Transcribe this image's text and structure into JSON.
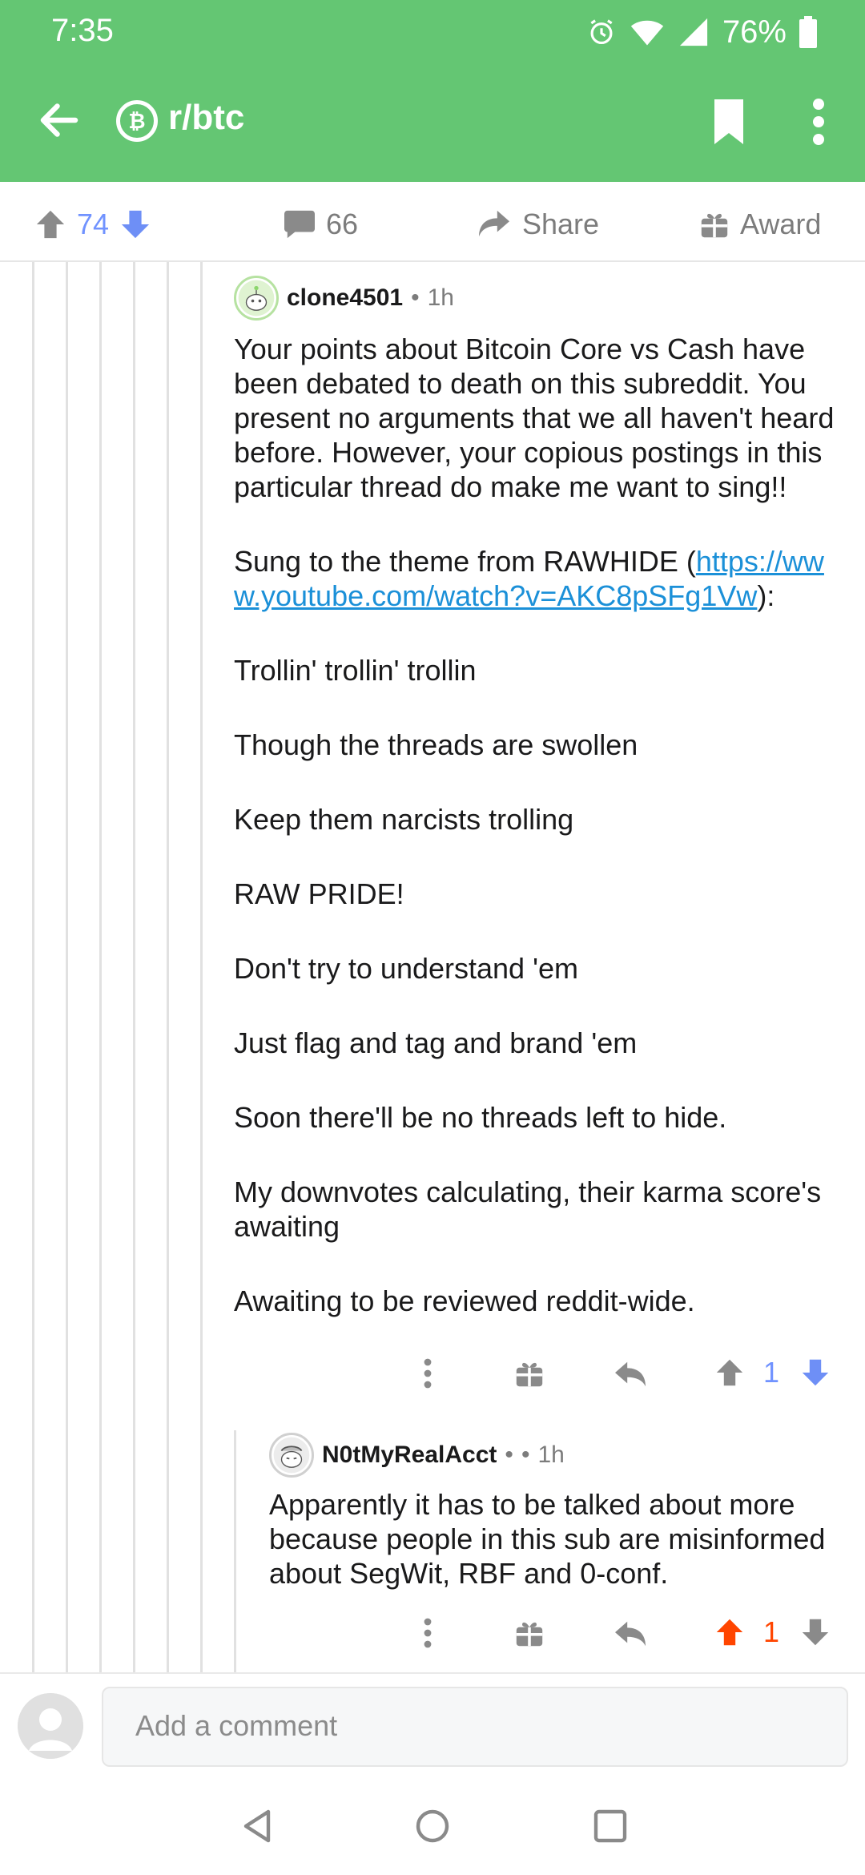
{
  "status_bar": {
    "time": "7:35",
    "battery": "76%"
  },
  "header": {
    "subreddit": "r/btc",
    "sub_icon_glyph": "₿"
  },
  "post_actions": {
    "votes": "74",
    "comments": "66",
    "share": "Share",
    "award": "Award"
  },
  "comment1": {
    "author": "clone4501",
    "sep": "•",
    "age": "1h",
    "p1": "Your points about Bitcoin Core vs Cash have been debated to death on this subreddit.  You present no arguments that we all haven't heard before.  However, your copious postings in this particular thread do make me want to sing!!",
    "p2_prefix": "Sung to the theme from RAWHIDE (",
    "p2_link": "https://www.youtube.com/watch?v=AKC8pSFg1Vw",
    "p2_suffix": "):",
    "lines": [
      "Trollin' trollin' trollin",
      "Though the threads are swollen",
      "Keep them narcists trolling",
      "RAW PRIDE!",
      "Don't try to understand 'em",
      "Just flag and tag and brand 'em",
      "Soon there'll be no threads left to hide.",
      "My downvotes calculating, their karma score's awaiting",
      "Awaiting to be reviewed reddit-wide."
    ],
    "score": "1"
  },
  "comment2": {
    "author": "N0tMyRealAcct",
    "sep": "•",
    "sep2": "•",
    "age": "1h",
    "body": "Apparently it has to be talked about more because people in this sub are misinformed about SegWit, RBF and 0-conf.",
    "score": "1"
  },
  "composer": {
    "placeholder": "Add a comment"
  },
  "colors": {
    "header_green": "#64c673",
    "upvote_orange": "#ff4500",
    "blue_vote": "#7193ff",
    "link_blue": "#1b90d8"
  }
}
